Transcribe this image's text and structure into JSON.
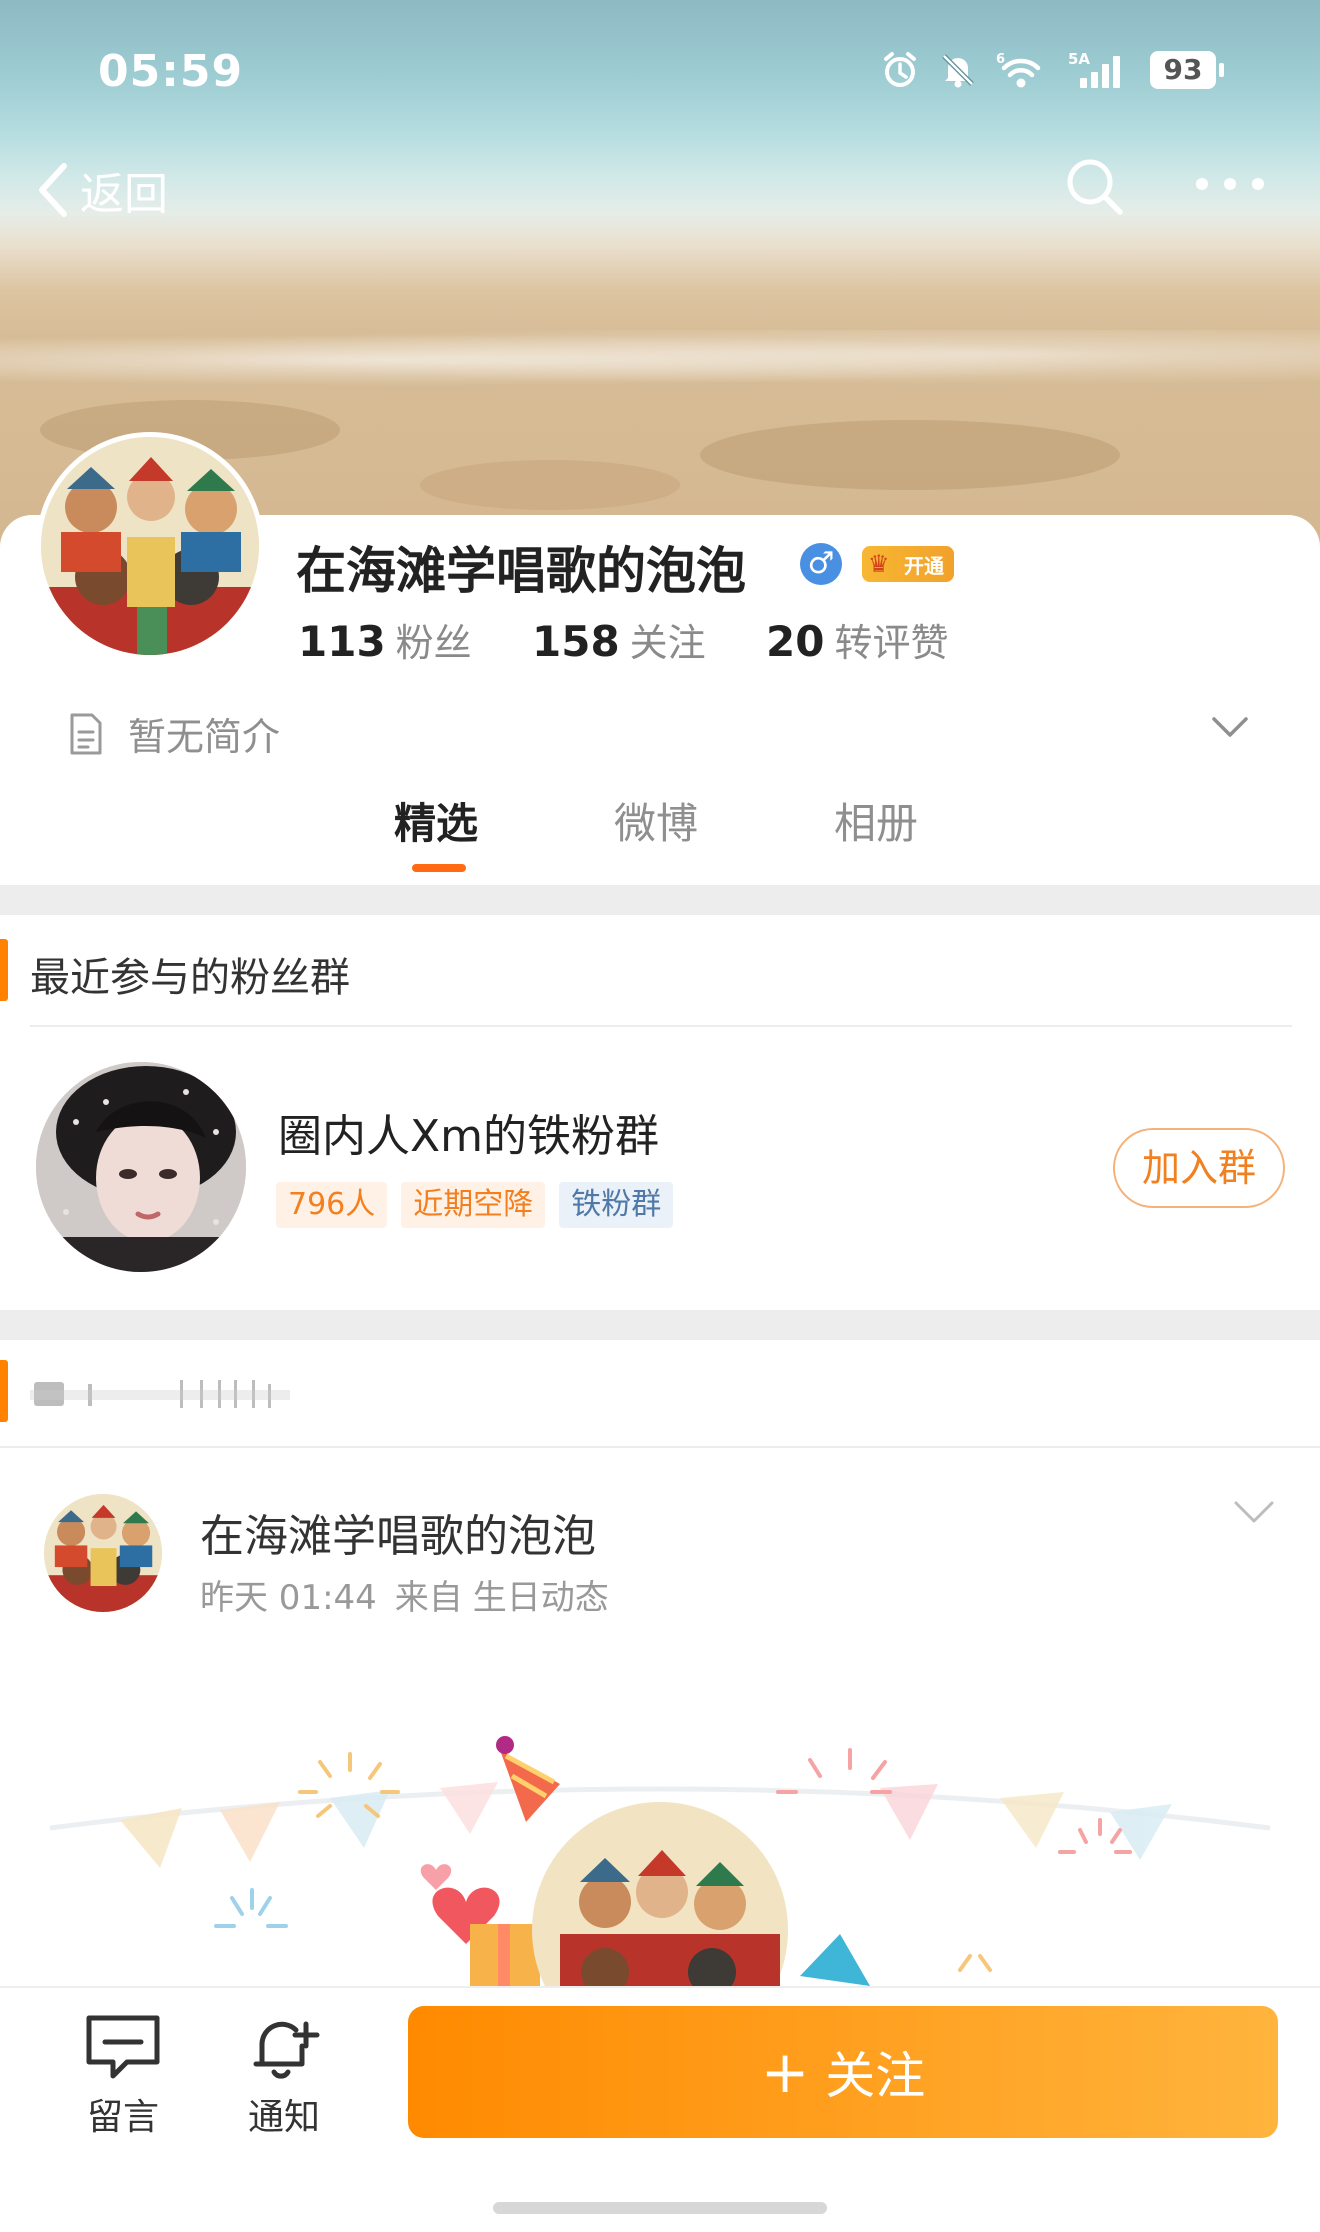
{
  "status_bar": {
    "time": "05:59",
    "battery": "93",
    "network": "5A",
    "wifi_badge": "6"
  },
  "nav": {
    "back_label": "返回"
  },
  "profile": {
    "name": "在海滩学唱歌的泡泡",
    "gender": "♂",
    "vip_label": "开通",
    "stats": [
      {
        "value": "113",
        "label": "粉丝"
      },
      {
        "value": "158",
        "label": "关注"
      },
      {
        "value": "20",
        "label": "转评赞"
      }
    ],
    "intro": "暂无简介"
  },
  "tabs": [
    {
      "label": "精选",
      "active": true
    },
    {
      "label": "微博",
      "active": false
    },
    {
      "label": "相册",
      "active": false
    }
  ],
  "fan_groups": {
    "section_title": "最近参与的粉丝群",
    "group": {
      "name": "圈内人Xm的铁粉群",
      "tags": [
        "796人",
        "近期空降",
        "铁粉群"
      ],
      "join_label": "加入群"
    }
  },
  "post": {
    "author": "在海滩学唱歌的泡泡",
    "time": "昨天 01:44",
    "source_prefix": "来自",
    "source": "生日动态"
  },
  "bottom_bar": {
    "message_label": "留言",
    "notify_label": "通知",
    "follow_label": "关注",
    "follow_icon": "+"
  },
  "colors": {
    "accent": "#ff8200",
    "follow_start": "#ff8a00",
    "follow_end": "#ffb43d",
    "tag_blue": "#5179a8"
  }
}
